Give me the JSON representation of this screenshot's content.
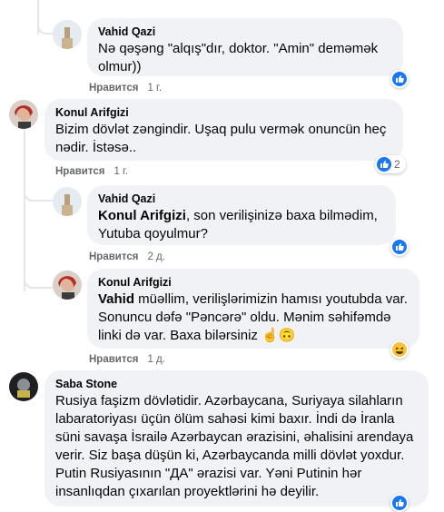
{
  "comments": [
    {
      "author": "Vahid Qazi",
      "text_parts": [
        "Nə qəşəng \"alqış\"dır, doktor. \"Amin\" deməmək olmur))"
      ],
      "action_label": "Нравится",
      "time": "1 г.",
      "reaction": "like",
      "reaction_count": ""
    },
    {
      "author": "Konul Arifgizi",
      "text_parts": [
        "Bizim dövlət zəngindir. Uşaq pulu vermək onuncün heç nədir. İstəsə.."
      ],
      "action_label": "Нравится",
      "time": "1 г.",
      "reaction": "like",
      "reaction_count": "2"
    },
    {
      "author": "Vahid Qazi",
      "mention": "Konul Arifgizi",
      "text_parts": [
        ", son verilişinizə baxa bilmədim, Yutuba qoyulmur?"
      ],
      "action_label": "Нравится",
      "time": "2 д.",
      "reaction": "like",
      "reaction_count": ""
    },
    {
      "author": "Konul Arifgizi",
      "mention": "Vahid",
      "text_parts": [
        " müəllim, verilişlərimizin hamısı youtubda var. Sonuncu dəfə \"Pəncərə\" oldu. Mənim səhifəmdə linki də var. Baxa bilərsiniz "
      ],
      "emoji_text": "☝🙃",
      "action_label": "Нравится",
      "time": "1 д.",
      "reaction": "haha",
      "reaction_count": ""
    },
    {
      "author": "Saba Stone",
      "text_parts": [
        "Rusiya faşizm dövlətidir. Azərbaycana, Suriyaya silahların labaratoriyası üçün ölüm sahəsi kimi baxır. İndi də İranla süni savaşa İsrailə Azərbaycan ərazisini, əhalisini arendaya verir. Siz başa düşün ki, Azərbaycanda milli dövlət yoxdur. Putin Rusiyasının \"ДА\" ərazisi var. Yəni Putinin hər insanlıqdan çıxarılan proyektlərini hə deyilir."
      ],
      "reaction": "like",
      "reaction_count": ""
    }
  ],
  "colors": {
    "bubble": "#f0f2f5",
    "like": "#1877f2",
    "meta": "#65676b"
  }
}
